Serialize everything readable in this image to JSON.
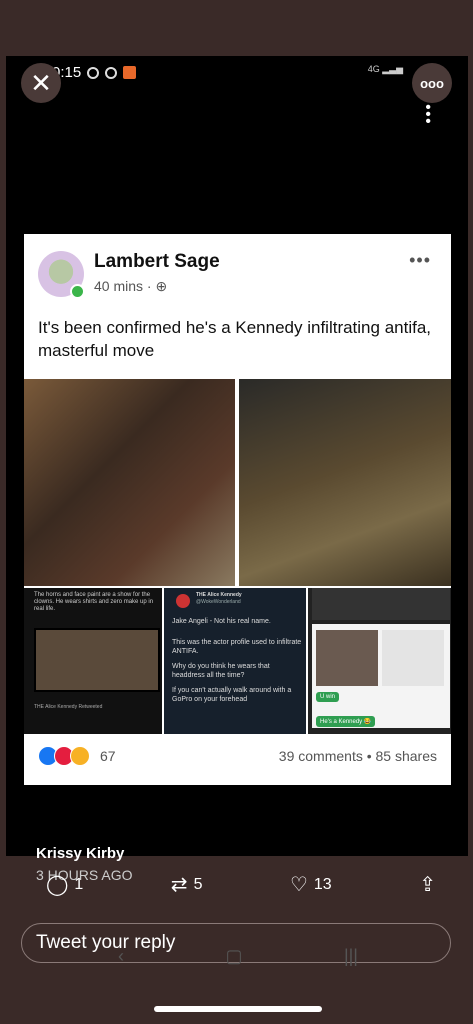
{
  "status_bar": {
    "time": "0:15",
    "network": "4G"
  },
  "viewer": {
    "close_icon": "close-icon",
    "more_icon": "more-dots-icon"
  },
  "post": {
    "author": "Lambert Sage",
    "time": "40 mins · ",
    "globe_icon": "globe-icon",
    "text": "It's been confirmed he's a Kennedy infiltrating antifa, masterful move",
    "reaction_count": "67",
    "comments_shares": "39 comments • 85 shares",
    "collage": {
      "caption_left": "The horns and face paint are a show for the clowns. He wears shirts and zero make up in real life.",
      "left_meta": "THE Alice Kennedy Retweeted",
      "tweet_name": "THE Alice Kennedy",
      "tweet_handle": "@WokeWonderland",
      "tweet_lines": [
        "Jake Angeli - Not his real name.",
        "This was the actor profile used to infiltrate ANTIFA.",
        "Why do you think he wears that headdress all the time?",
        "If you can't actually walk around with a GoPro on your forehead"
      ],
      "chat_uwin": "U win",
      "chat_kennedy": "He's a Kennedy 😂"
    }
  },
  "tweet": {
    "author": "Krissy Kirby",
    "time": "3 HOURS AGO",
    "replies": "1",
    "retweets": "5",
    "likes": "13",
    "reply_placeholder": "Tweet your reply"
  }
}
